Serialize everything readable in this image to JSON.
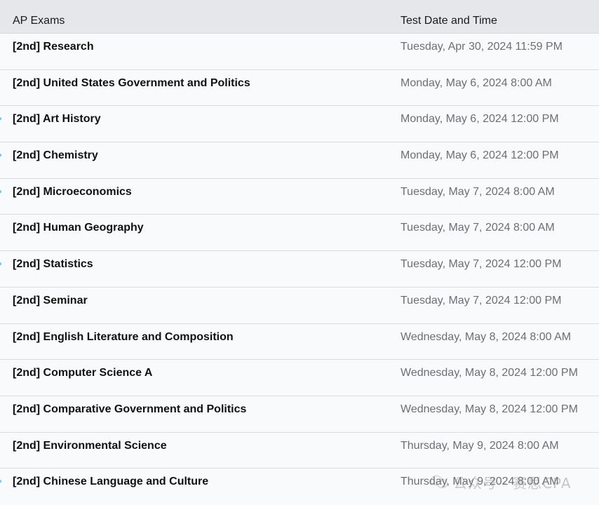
{
  "table": {
    "headers": {
      "exam": "AP Exams",
      "date": "Test Date and Time"
    },
    "rows": [
      {
        "exam": "[2nd] Research",
        "date": "Tuesday, Apr 30, 2024 11:59 PM"
      },
      {
        "exam": "[2nd] United States Government and Politics",
        "date": "Monday, May 6, 2024 8:00 AM"
      },
      {
        "exam": "[2nd] Art History",
        "date": "Monday, May 6, 2024 12:00 PM"
      },
      {
        "exam": "[2nd] Chemistry",
        "date": "Monday, May 6, 2024 12:00 PM"
      },
      {
        "exam": "[2nd] Microeconomics",
        "date": "Tuesday, May 7, 2024 8:00 AM"
      },
      {
        "exam": "[2nd] Human Geography",
        "date": "Tuesday, May 7, 2024 8:00 AM"
      },
      {
        "exam": "[2nd] Statistics",
        "date": "Tuesday, May 7, 2024 12:00 PM"
      },
      {
        "exam": "[2nd] Seminar",
        "date": "Tuesday, May 7, 2024 12:00 PM"
      },
      {
        "exam": "[2nd] English Literature and Composition",
        "date": "Wednesday, May 8, 2024 8:00 AM"
      },
      {
        "exam": "[2nd] Computer Science A",
        "date": "Wednesday, May 8, 2024 12:00 PM"
      },
      {
        "exam": "[2nd] Comparative Government and Politics",
        "date": "Wednesday, May 8, 2024 12:00 PM"
      },
      {
        "exam": "[2nd] Environmental Science",
        "date": "Thursday, May 9, 2024 8:00 AM"
      },
      {
        "exam": "[2nd] Chinese Language and Culture",
        "date": "Thursday, May 9, 2024 8:00 AM"
      }
    ]
  },
  "watermark": {
    "text": "公众号 · 赛思CPA"
  },
  "colors": {
    "header_bg": "#e6e7ea",
    "row_bg": "#f9fafb",
    "divider": "#dcdde0",
    "exam_text": "#111111",
    "date_text": "#6e6e73"
  }
}
